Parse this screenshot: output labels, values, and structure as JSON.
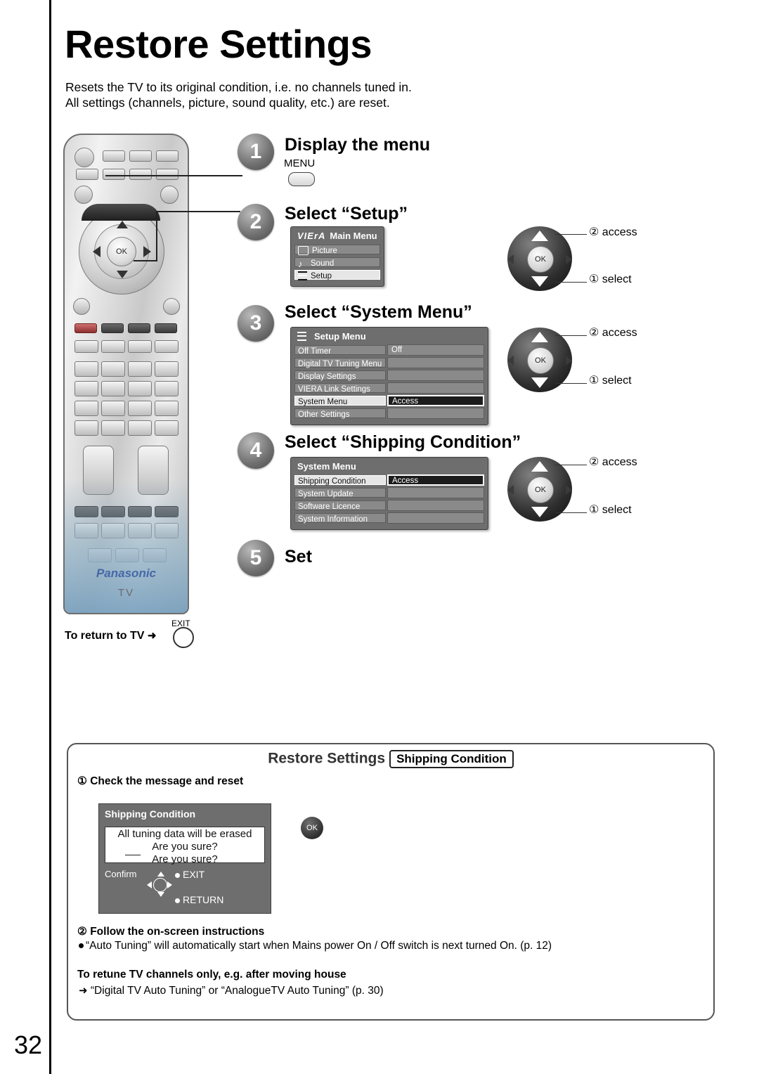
{
  "page": {
    "title": "Restore Settings",
    "intro_line1": "Resets the TV to its original condition, i.e. no channels tuned in.",
    "intro_line2": "All settings (channels, picture, sound quality, etc.) are reset.",
    "number": "32"
  },
  "remote": {
    "brand": "Panasonic",
    "tv_label": "TV",
    "ok_label": "OK"
  },
  "steps": [
    {
      "num": "1",
      "title": "Display the menu",
      "key_label": "MENU"
    },
    {
      "num": "2",
      "title": "Select “Setup”"
    },
    {
      "num": "3",
      "title": "Select “System Menu”"
    },
    {
      "num": "4",
      "title": "Select “Shipping Condition”"
    },
    {
      "num": "5",
      "title": "Set"
    }
  ],
  "main_menu": {
    "logo": "VIErA",
    "title": "Main Menu",
    "rows": [
      {
        "label": "Picture",
        "icon": "picture-icon"
      },
      {
        "label": "Sound",
        "icon": "sound-icon"
      },
      {
        "label": "Setup",
        "icon": "setup-icon",
        "selected": true
      }
    ]
  },
  "setup_menu": {
    "title": "Setup Menu",
    "rows": [
      {
        "label": "Off Timer",
        "value": "Off"
      },
      {
        "label": "Digital TV Tuning Menu",
        "value": ""
      },
      {
        "label": "Display Settings",
        "value": ""
      },
      {
        "label": "VIERA Link Settings",
        "value": ""
      },
      {
        "label": "System Menu",
        "value": "Access",
        "selected": true
      },
      {
        "label": "Other Settings",
        "value": ""
      }
    ]
  },
  "system_menu": {
    "title": "System Menu",
    "rows": [
      {
        "label": "Shipping Condition",
        "value": "Access",
        "selected": true
      },
      {
        "label": "System Update",
        "value": ""
      },
      {
        "label": "Software Licence",
        "value": ""
      },
      {
        "label": "System Information",
        "value": ""
      }
    ]
  },
  "navpads": [
    {
      "access": "② access",
      "select": "① select",
      "ok": "OK"
    },
    {
      "access": "② access",
      "select": "① select",
      "ok": "OK"
    },
    {
      "access": "② access",
      "select": "① select",
      "ok": "OK"
    }
  ],
  "return_to_tv": {
    "text": "To return to TV",
    "arrow": "➜",
    "exit_label": "EXIT"
  },
  "panel": {
    "heading": "Restore Settings",
    "chip": "Shipping Condition",
    "step1": "① Check the message and reset",
    "dialog": {
      "title": "Shipping Condition",
      "message_line1": "All tuning data will be erased",
      "message_line2": "Are you sure?",
      "message_line3": "Are you sure?",
      "confirm_label": "Confirm",
      "exit_label": "EXIT",
      "return_label": "RETURN",
      "ok_label": "OK"
    },
    "step2": "② Follow the on-screen instructions",
    "step2_note": "“Auto Tuning” will automatically start when Mains power On / Off switch is next turned On. (p. 12)",
    "retune_heading": "To retune TV channels only, e.g. after moving house",
    "retune_note": "“Digital TV Auto Tuning” or “AnalogueTV Auto Tuning” (p. 30)",
    "retune_arrow": "➜"
  },
  "colors": {
    "osd_bg": "#6e6e6e",
    "osd_row": "#8a8a8a",
    "selected_row": "#e6e6e6",
    "selected_value_bg": "#1c1c1c",
    "brand_blue": "#4668a8"
  }
}
